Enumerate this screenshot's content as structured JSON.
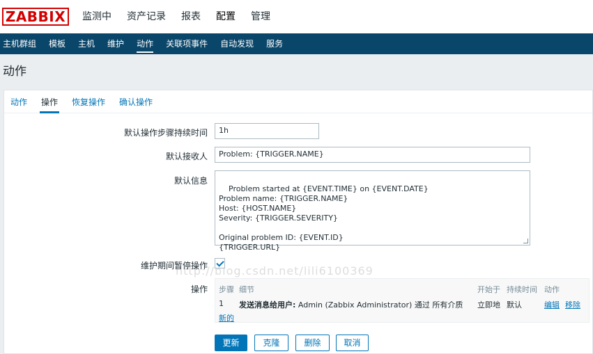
{
  "header": {
    "logo": "ZABBIX",
    "nav": [
      "监测中",
      "资产记录",
      "报表",
      "配置",
      "管理"
    ]
  },
  "subnav": [
    "主机群组",
    "模板",
    "主机",
    "维护",
    "动作",
    "关联项事件",
    "自动发现",
    "服务"
  ],
  "page_title": "动作",
  "tabs": [
    "动作",
    "操作",
    "恢复操作",
    "确认操作"
  ],
  "form": {
    "step_duration_label": "默认操作步骤持续时间",
    "step_duration_value": "1h",
    "subject_label": "默认接收人",
    "subject_value": "Problem: {TRIGGER.NAME}",
    "message_label": "默认信息",
    "message_value": "Problem started at {EVENT.TIME} on {EVENT.DATE}\nProblem name: {TRIGGER.NAME}\nHost: {HOST.NAME}\nSeverity: {TRIGGER.SEVERITY}\n\nOriginal problem ID: {EVENT.ID}\n{TRIGGER.URL}",
    "pause_label": "维护期间暂停操作",
    "pause_checked": true,
    "operations_label": "操作"
  },
  "operations": {
    "headers": {
      "step": "步骤",
      "details": "细节",
      "start_in": "开始于",
      "duration": "持续时间",
      "action": "动作"
    },
    "rows": [
      {
        "step": "1",
        "details_bold": "发送消息给用户:",
        "details_rest": " Admin (Zabbix Administrator) 通过 所有介质",
        "start_in": "立即地",
        "duration": "默认",
        "edit": "编辑",
        "remove": "移除"
      }
    ],
    "new_link": "新的"
  },
  "buttons": {
    "update": "更新",
    "clone": "克隆",
    "delete": "删除",
    "cancel": "取消"
  },
  "watermark": "http://blog.csdn.net/lili6100369"
}
